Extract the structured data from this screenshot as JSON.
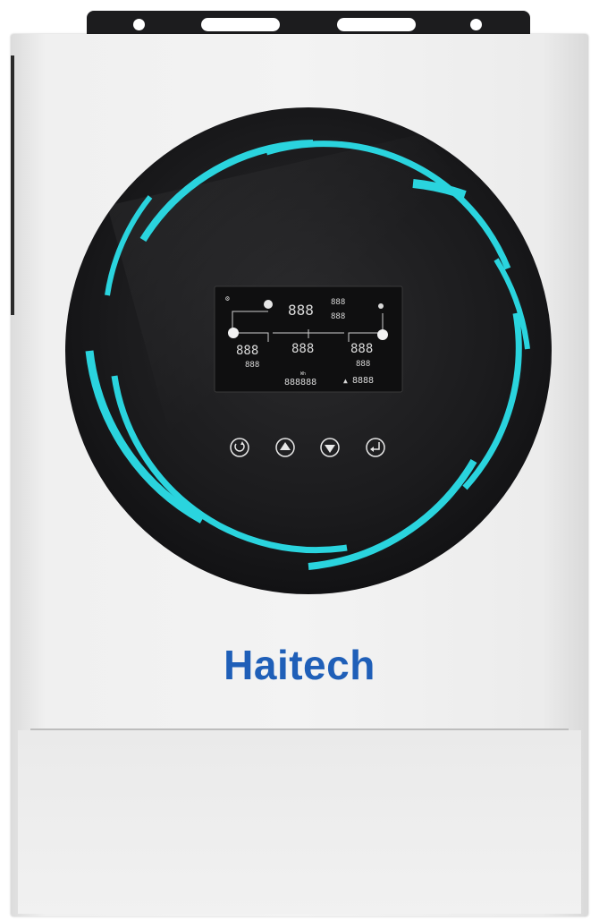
{
  "brand": {
    "name": "Haitech",
    "color": "#1f5fb8"
  },
  "device": {
    "type": "solar-inverter",
    "ring_color": "#29d3dd",
    "face_color": "#1b1b1d",
    "body_color": "#f2f2f2"
  },
  "lcd": {
    "main_digits": "888",
    "small_digits": "888",
    "wide_digits": "888888",
    "right_digits": "8888",
    "unit_label": "Wh"
  },
  "buttons": [
    {
      "name": "escape-button",
      "icon": "circular-arrow-icon"
    },
    {
      "name": "up-button",
      "icon": "triangle-up-icon"
    },
    {
      "name": "down-button",
      "icon": "triangle-down-icon"
    },
    {
      "name": "enter-button",
      "icon": "return-arrow-icon"
    }
  ]
}
